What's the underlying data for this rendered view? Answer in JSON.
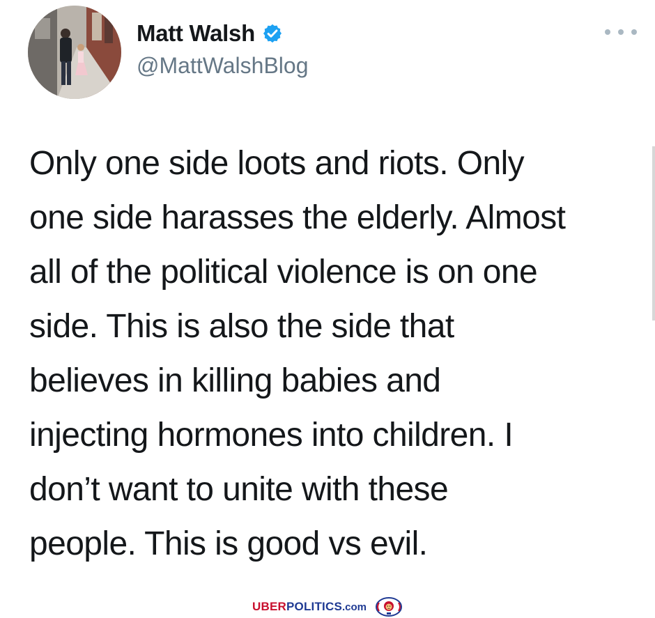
{
  "author": {
    "name": "Matt Walsh",
    "handle": "@MattWalshBlog",
    "verified": true,
    "avatar_icon": "profile-photo",
    "verified_icon": "verified-badge-icon"
  },
  "menu": {
    "icon": "more-options-icon"
  },
  "tweet": {
    "lines": [
      "Only one side loots and riots. Only",
      "one side harasses the elderly. Almost",
      "all of the political violence is on one",
      "side. This is also the side that",
      "believes in killing babies and",
      "injecting hormones into children. I",
      "don’t want to unite with these",
      "people. This is good vs evil."
    ]
  },
  "watermark": {
    "part1": "UBER",
    "part2": "POLITICS",
    "part3": ".com",
    "logo_icon": "lion-shield-logo"
  },
  "colors": {
    "text": "#14171a",
    "secondary": "#657786",
    "verified_blue": "#1da1f2",
    "watermark_red": "#c8102e",
    "watermark_blue": "#1f3a93"
  }
}
